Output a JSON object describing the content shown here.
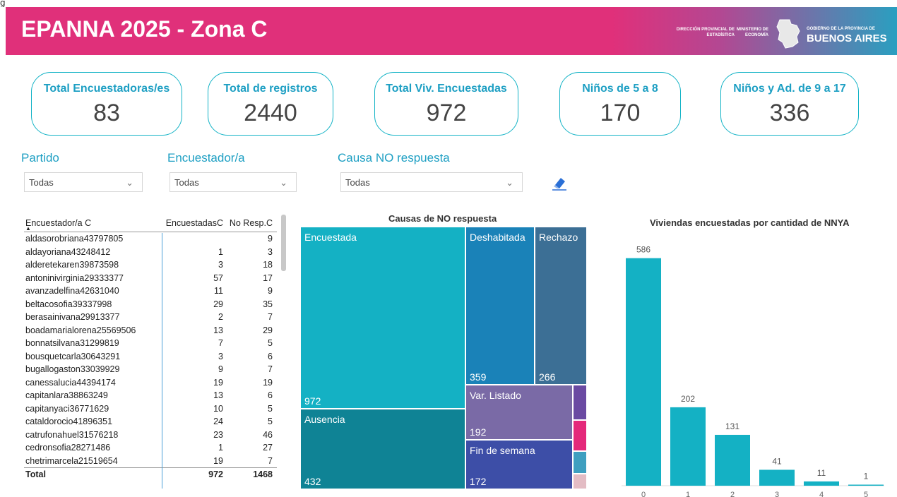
{
  "page_top_text": "g",
  "header": {
    "title": "EPANNA 2025 - Zona C",
    "logo_estadistica": "DIRECCIÓN PROVINCIAL DE ESTADÍSTICA",
    "logo_ministerio": "MINISTERIO DE ECONOMÍA",
    "logo_gobierno_small": "GOBIERNO DE LA PROVINCIA DE",
    "logo_gobierno_big": "BUENOS AIRES"
  },
  "kpis": [
    {
      "label": "Total Encuestadoras/es",
      "value": "83"
    },
    {
      "label": "Total de registros",
      "value": "2440"
    },
    {
      "label": "Total Viv. Encuestadas",
      "value": "972"
    },
    {
      "label": "Niños de 5 a 8",
      "value": "170"
    },
    {
      "label": "Niños y Ad. de 9 a 17",
      "value": "336"
    }
  ],
  "filters": [
    {
      "label": "Partido",
      "value": "Todas"
    },
    {
      "label": "Encuestador/a",
      "value": "Todas"
    },
    {
      "label": "Causa NO respuesta",
      "value": "Todas"
    }
  ],
  "clear_icon": "eraser-icon",
  "table": {
    "headers": [
      "Encuestador/a C",
      "EncuestadasC",
      "No Resp.C"
    ],
    "rows": [
      [
        "aldasorobriana43797805",
        "",
        "9"
      ],
      [
        "aldayoriana43248412",
        "1",
        "3"
      ],
      [
        "alderetekaren39873598",
        "3",
        "18"
      ],
      [
        "antoninivirginia29333377",
        "57",
        "17"
      ],
      [
        "avanzadelfina42631040",
        "11",
        "9"
      ],
      [
        "beltacosofia39337998",
        "29",
        "35"
      ],
      [
        "berasainivana29913377",
        "2",
        "7"
      ],
      [
        "boadamarialorena25569506",
        "13",
        "29"
      ],
      [
        "bonnatsilvana31299819",
        "7",
        "5"
      ],
      [
        "bousquetcarla30643291",
        "3",
        "6"
      ],
      [
        "bugallogaston33039929",
        "9",
        "7"
      ],
      [
        "canessalucia44394174",
        "19",
        "19"
      ],
      [
        "capitanlara38863249",
        "13",
        "6"
      ],
      [
        "capitanyaci36771629",
        "10",
        "5"
      ],
      [
        "cataldorocio41896351",
        "24",
        "5"
      ],
      [
        "catrufonahuel31576218",
        "23",
        "46"
      ],
      [
        "cedronsofia28271486",
        "1",
        "27"
      ],
      [
        "chetrimarcela21519654",
        "19",
        "7"
      ]
    ],
    "total": [
      "Total",
      "972",
      "1468"
    ]
  },
  "treemap": {
    "title": "Causas de NO respuesta",
    "tiles": [
      {
        "label": "Encuestada",
        "value": "972",
        "color": "#14b1c4"
      },
      {
        "label": "Ausencia",
        "value": "432",
        "color": "#0f8395"
      },
      {
        "label": "Deshabitada",
        "value": "359",
        "color": "#1a82b8"
      },
      {
        "label": "Rechazo",
        "value": "266",
        "color": "#3c6f95"
      },
      {
        "label": "Var. Listado",
        "value": "192",
        "color": "#7a6aa6"
      },
      {
        "label": "Fin de semana",
        "value": "172",
        "color": "#3d4ea7"
      }
    ],
    "small_colors": [
      "#6a4aa2",
      "#e4287a",
      "#3e9fc0",
      "#e3bcc4"
    ]
  },
  "chart_data": {
    "type": "bar",
    "title": "Viviendas encuestadas por cantidad de NNYA",
    "categories": [
      "0",
      "1",
      "2",
      "3",
      "4",
      "5"
    ],
    "values": [
      586,
      202,
      131,
      41,
      11,
      1
    ],
    "xlabel": "",
    "ylabel": "",
    "ylim": [
      0,
      600
    ],
    "grid": false,
    "color": "#14b1c4"
  }
}
